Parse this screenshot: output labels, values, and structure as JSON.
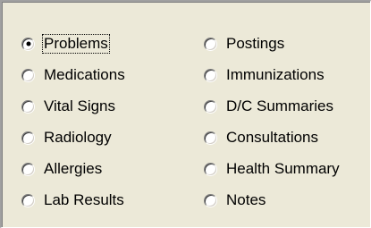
{
  "left_column": [
    {
      "label": "Problems",
      "checked": true,
      "focused": true
    },
    {
      "label": "Medications",
      "checked": false,
      "focused": false
    },
    {
      "label": "Vital Signs",
      "checked": false,
      "focused": false
    },
    {
      "label": "Radiology",
      "checked": false,
      "focused": false
    },
    {
      "label": "Allergies",
      "checked": false,
      "focused": false
    },
    {
      "label": "Lab Results",
      "checked": false,
      "focused": false
    }
  ],
  "right_column": [
    {
      "label": "Postings",
      "checked": false,
      "focused": false
    },
    {
      "label": "Immunizations",
      "checked": false,
      "focused": false
    },
    {
      "label": "D/C Summaries",
      "checked": false,
      "focused": false
    },
    {
      "label": "Consultations",
      "checked": false,
      "focused": false
    },
    {
      "label": "Health Summary",
      "checked": false,
      "focused": false
    },
    {
      "label": "Notes",
      "checked": false,
      "focused": false
    }
  ]
}
